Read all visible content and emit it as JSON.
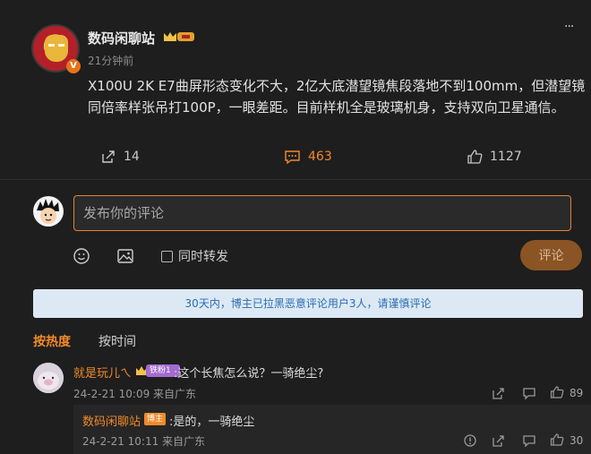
{
  "post": {
    "username": "数码闲聊站",
    "v_badge": "V",
    "timestamp": "21分钟前",
    "more": "···",
    "body": "X100U 2K E7曲屏形态变化不大，2亿大底潜望镜焦段落地不到100mm，但潜望镜同倍率样张吊打100P，一眼差距。目前样机全是玻璃机身，支持双向卫星通信。",
    "share_count": "14",
    "comment_count": "463",
    "like_count": "1127"
  },
  "composer": {
    "placeholder": "发布你的评论",
    "forward_label": "同时转发",
    "submit_label": "评论"
  },
  "notice": "30天内，博主已拉黑恶意评论用户3人，请谨慎评论",
  "sort": {
    "hot": "按热度",
    "time": "按时间"
  },
  "comment": {
    "name": "就是玩儿ㄟ",
    "badge": "铁粉1",
    "text": ":这个长焦怎么说？一骑绝尘?",
    "meta": "24-2-21 10:09 来自广东",
    "like_count": "89"
  },
  "reply": {
    "name": "数码闲聊站",
    "host_badge": "博主",
    "text": ":是的，一骑绝尘",
    "meta": "24-2-21 10:11 来自广东",
    "like_count": "30"
  },
  "colors": {
    "accent": "#f08a2b",
    "background": "#1e1e1e",
    "notice_bg": "#dce9f5",
    "notice_text": "#2c6bb0"
  }
}
